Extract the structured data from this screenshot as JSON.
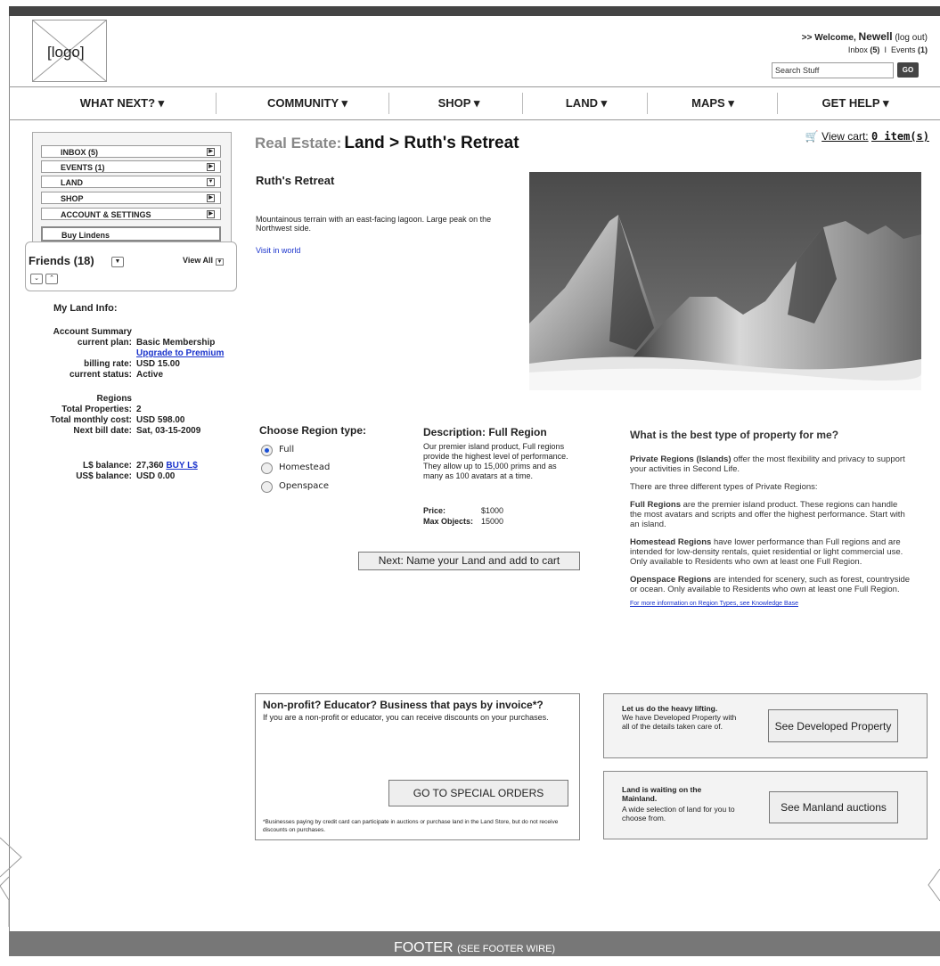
{
  "header": {
    "logo_text": "[logo]",
    "welcome_prefix": ">> Welcome,",
    "user_name": "Newell",
    "logout": "(log out)",
    "inbox_label": "Inbox",
    "inbox_count": "(5)",
    "separator": "I",
    "events_label": "Events",
    "events_count": "(1)",
    "search_value": "Search Stuff",
    "go_label": "GO"
  },
  "nav": {
    "items": [
      "WHAT NEXT?",
      "COMMUNITY",
      "SHOP",
      "LAND",
      "MAPS",
      "GET HELP"
    ]
  },
  "sidebar": {
    "items": [
      "INBOX (5)",
      "EVENTS (1)",
      "LAND",
      "SHOP",
      "ACCOUNT & SETTINGS",
      "Buy Lindens"
    ],
    "friends_label": "Friends (18)",
    "view_all": "View All",
    "land_info_title": "My Land Info:",
    "account_summary": "Account Summary",
    "current_plan_label": "current plan:",
    "current_plan": "Basic Membership",
    "upgrade_link": "Upgrade to Premium",
    "billing_rate_label": "billing rate:",
    "billing_rate": "USD 15.00",
    "current_status_label": "current status:",
    "current_status": "Active",
    "regions_label": "Regions",
    "total_properties_label": "Total Properties:",
    "total_properties": "2",
    "monthly_cost_label": "Total monthly cost:",
    "monthly_cost": "USD 598.00",
    "next_bill_label": "Next bill date:",
    "next_bill": "Sat, 03-15-2009",
    "ls_balance_label": "L$ balance:",
    "ls_balance": "27,360",
    "buy_ls": "BUY L$",
    "us_balance_label": "US$ balance:",
    "us_balance": "USD 0.00"
  },
  "main": {
    "heading_prefix": "Real Estate:",
    "heading": "Land > Ruth's Retreat",
    "cart_label": "View cart:",
    "cart_items": "0 item(s)",
    "property_title": "Ruth's Retreat",
    "property_desc": "Mountainous terrain with an east-facing lagoon. Large peak on the Northwest side.",
    "visit_link": "Visit in world",
    "choose_region_title": "Choose Region type:",
    "region_options": [
      "Full",
      "Homestead",
      "Openspace"
    ],
    "selected_region": "Full",
    "desc_title": "Description: Full Region",
    "desc_text": "Our premier island product, Full regions provide the highest level of performance. They allow up to 15,000 prims and as many as 100 avatars at a time.",
    "price_label": "Price:",
    "price": "$1000",
    "max_objects_label": "Max Objects:",
    "max_objects": "15000",
    "next_button": "Next: Name your Land and add to cart"
  },
  "info": {
    "title": "What is the best type of property for me?",
    "private_bold": "Private Regions (Islands)",
    "private_text": " offer the most flexibility and privacy to support your activities in Second Life.",
    "three_types": "There are three different types of Private Regions:",
    "full_bold": "Full Regions",
    "full_text": " are the premier island product. These regions can handle the most avatars and scripts and offer the highest performance. Start with an island.",
    "homestead_bold": "Homestead Regions",
    "homestead_text": " have lower performance than Full regions and are intended for low-density rentals, quiet residential or light commercial use. Only available to Residents who own at least one Full Region.",
    "openspace_bold": "Openspace Regions",
    "openspace_text": " are intended for scenery, such as forest, countryside or ocean. Only available to Residents who own at least one Full Region.",
    "kb_link": "For more information on Region Types, see Knowledge Base"
  },
  "special": {
    "title": "Non-profit? Educator?  Business that pays by invoice*?",
    "text": "If you are a non-profit or educator, you can receive discounts on your purchases.",
    "button": "GO TO SPECIAL ORDERS",
    "footnote": "*Businesses paying by credit card can participate in auctions or purchase land in the Land Store, but do not receive discounts on purchases."
  },
  "developed": {
    "title": "Let us do the heavy lifting.",
    "text": "We have Developed Property with all of the details taken care of.",
    "button": "See Developed Property"
  },
  "auctions": {
    "title": "Land is waiting on the Mainland.",
    "text": "A wide selection of land for you to choose from.",
    "button": "See Manland auctions"
  },
  "footer": {
    "label": "FOOTER",
    "note": "(SEE FOOTER WIRE)"
  }
}
